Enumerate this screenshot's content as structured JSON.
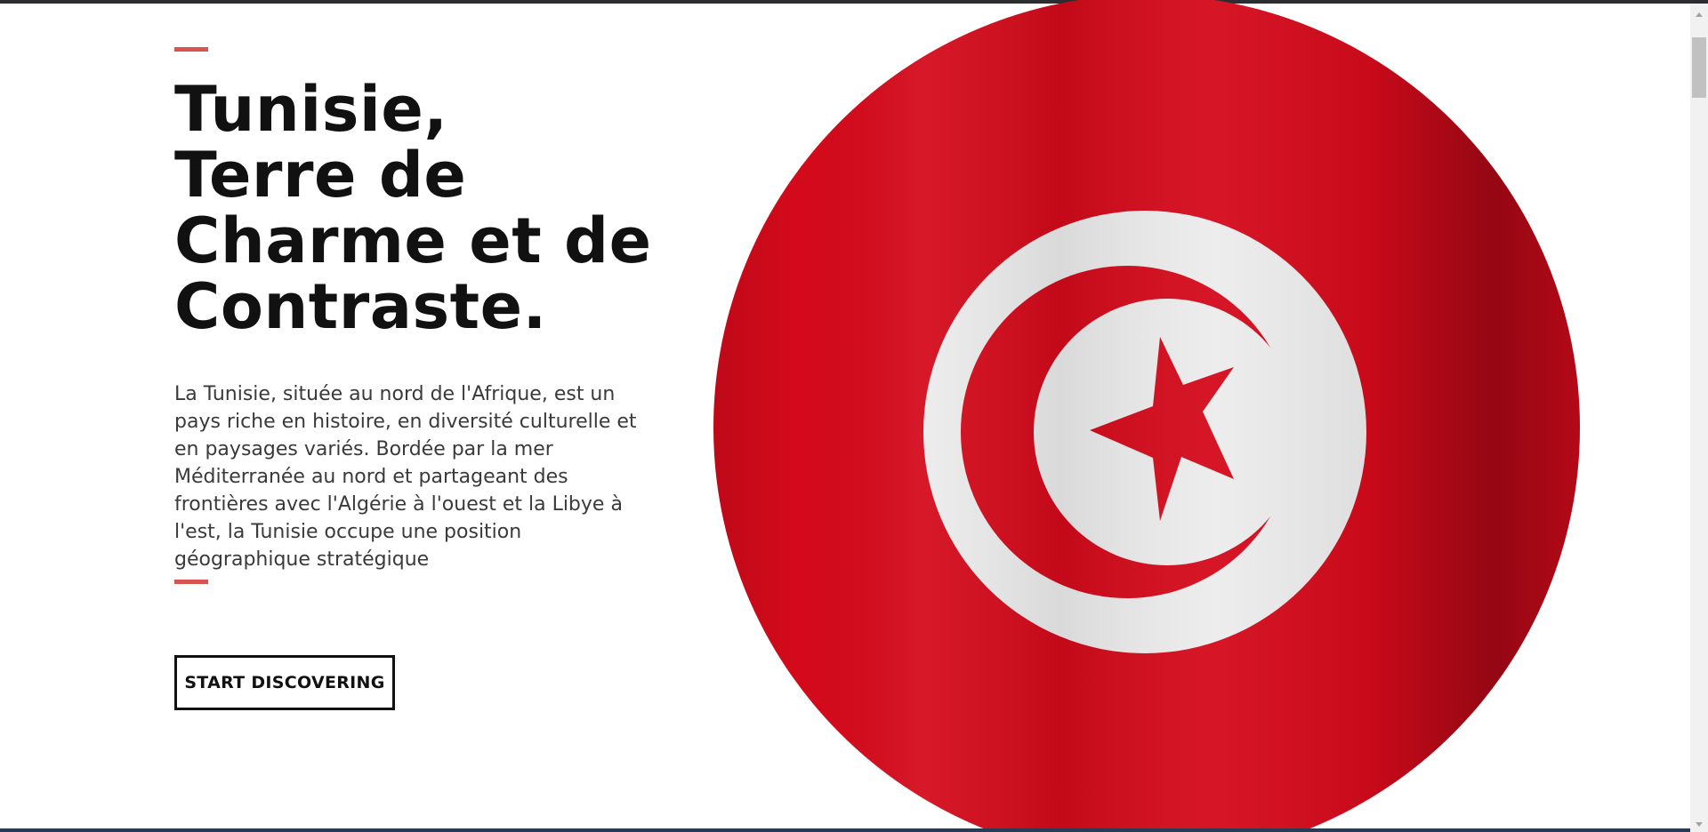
{
  "hero": {
    "headline_lines": [
      "Tunisie,",
      "Terre de",
      "Charme et de",
      "Contraste."
    ],
    "description": "La Tunisie, située au nord de l'Afrique, est un pays riche en histoire, en diversité culturelle et en paysages variés. Bordée par la mer Méditerranée au nord et partageant des frontières avec l'Algérie à l'ouest et la Libye à l'est, la Tunisie occupe une position géographique stratégique",
    "cta_label": "START DISCOVERING"
  },
  "image": {
    "subject": "tunisia-flag-icon"
  },
  "colors": {
    "accent": "#d9534f",
    "flag_red": "#d40a1b",
    "flag_white": "#ececec",
    "text_dark": "#111111",
    "text_body": "#3a3a3a"
  }
}
